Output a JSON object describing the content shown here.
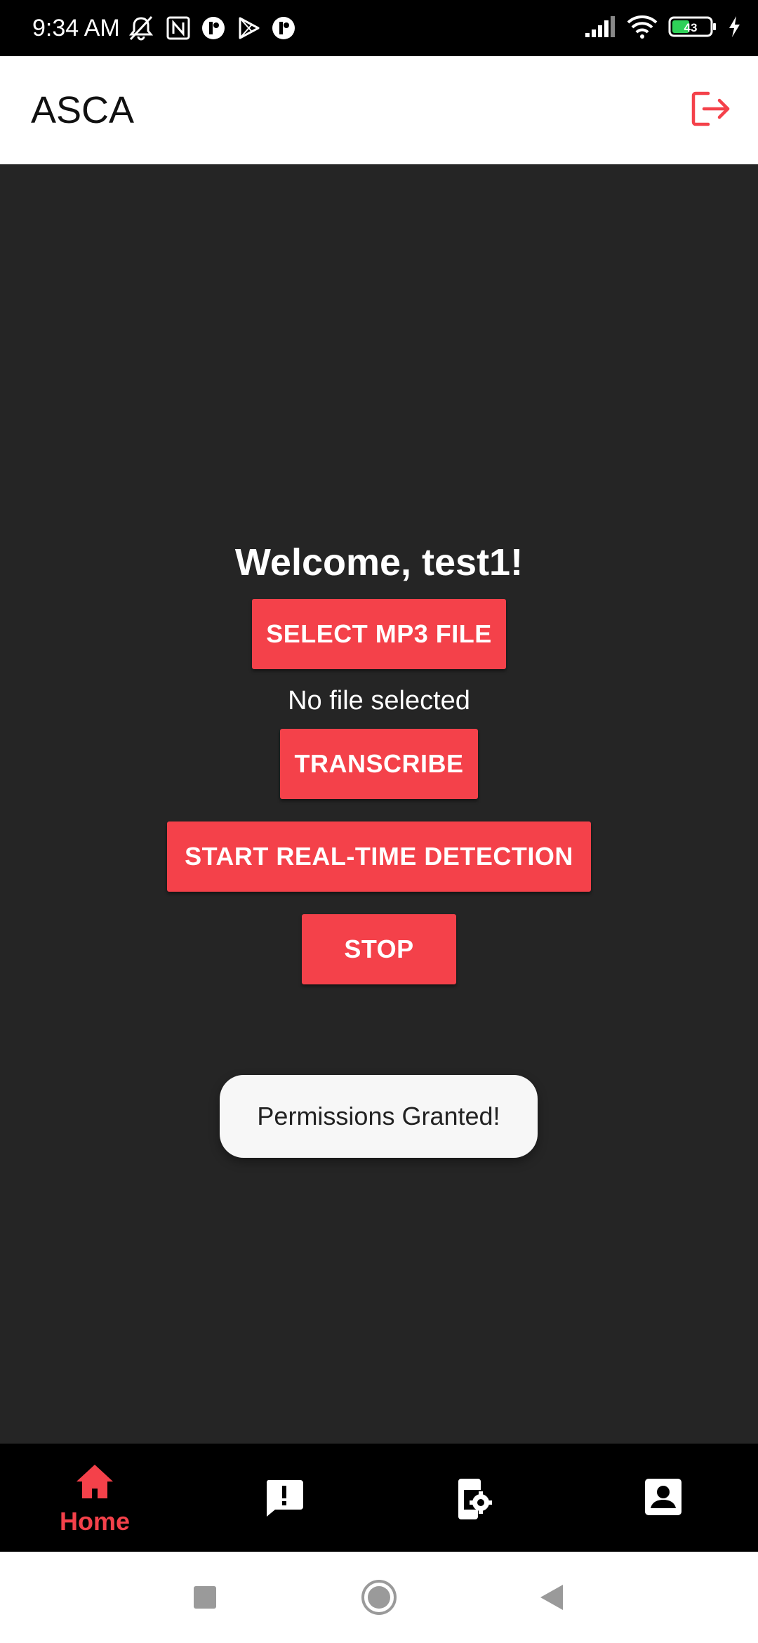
{
  "status_bar": {
    "time": "9:34 AM",
    "battery_level": "43",
    "icons_left": [
      "mute-icon",
      "nfc-icon",
      "app-notification-icon",
      "play-store-icon",
      "app-notification-icon"
    ],
    "icons_right": [
      "signal-icon",
      "wifi-icon",
      "battery-icon",
      "charging-icon"
    ]
  },
  "app_bar": {
    "title": "ASCA",
    "logout_icon": "logout-icon"
  },
  "main": {
    "welcome_text": "Welcome, test1!",
    "select_button_label": "SELECT MP3 FILE",
    "file_status": "No file selected",
    "transcribe_button_label": "TRANSCRIBE",
    "realtime_button_label": "START REAL-TIME DETECTION",
    "stop_button_label": "STOP"
  },
  "toast": {
    "message": "Permissions Granted!"
  },
  "bottom_nav": {
    "items": [
      {
        "label": "Home",
        "icon": "home-icon",
        "active": true
      },
      {
        "label": "",
        "icon": "alert-message-icon",
        "active": false
      },
      {
        "label": "",
        "icon": "device-settings-icon",
        "active": false
      },
      {
        "label": "",
        "icon": "profile-icon",
        "active": false
      }
    ]
  },
  "system_nav": {
    "buttons": [
      "recents-icon",
      "home-circle-icon",
      "back-icon"
    ]
  },
  "colors": {
    "accent": "#f4414a",
    "background": "#252525",
    "app_bar": "#ffffff",
    "nav_bar": "#000000",
    "toast": "#f7f7f7"
  }
}
